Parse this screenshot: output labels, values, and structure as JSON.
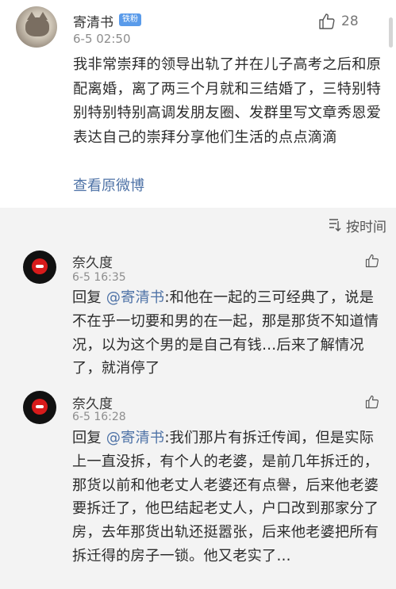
{
  "main_comment": {
    "username": "寄清书",
    "badge": "铁粉",
    "time": "6-5 02:50",
    "like_count": "28",
    "text": "我非常崇拜的领导出轨了并在儿子高考之后和原配离婚，离了两三个月就和三结婚了，三特别特别特别特别高调发朋友圈、发群里写文章秀恩爱表达自己的崇拜分享他们生活的点点滴滴",
    "view_original": "查看原微博"
  },
  "sort": {
    "label": "按时间"
  },
  "replies": [
    {
      "username": "奈久度",
      "time": "6-5 16:35",
      "reply_prefix": "回复",
      "mention": "@寄清书",
      "text": ":和他在一起的三可经典了，说是不在乎一切要和男的在一起，那是那货不知道情况，以为这个男的是自己有钱…后来了解情况了，就消停了"
    },
    {
      "username": "奈久度",
      "time": "6-5 16:28",
      "reply_prefix": "回复",
      "mention": "@寄清书",
      "text": ":我们那片有拆迁传闻，但是实际上一直没拆，有个人的老婆，是前几年拆迁的，那货以前和他老丈人老婆还有点譽，后来他老婆要拆迁了，他巴结起老丈人，户口改到那家分了房，去年那货出轨还挺嚣张，后来他老婆把所有拆迁得的房子一锁。他又老实了…"
    }
  ],
  "colors": {
    "link": "#4f73a7",
    "badge": "#5a9bea",
    "reply_background": "#f3f3f3",
    "avatar_red": "#d81b1b"
  },
  "icons": {
    "like": "thumbs-up-icon",
    "sort": "sort-icon"
  }
}
